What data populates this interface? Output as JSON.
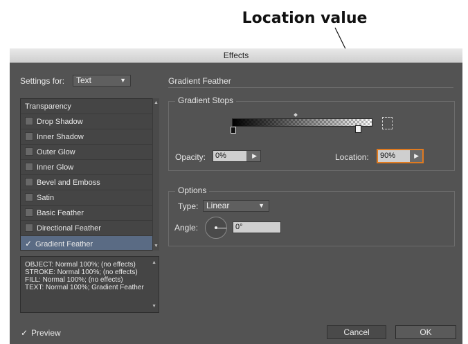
{
  "callout": {
    "text": "Location value"
  },
  "dialog": {
    "title": "Effects",
    "settings_for_label": "Settings for:",
    "settings_for_value": "Text",
    "section_title": "Gradient Feather",
    "effects_list": [
      {
        "label": "Transparency",
        "checkbox": false
      },
      {
        "label": "Drop Shadow",
        "checkbox": true,
        "checked": false
      },
      {
        "label": "Inner Shadow",
        "checkbox": true,
        "checked": false
      },
      {
        "label": "Outer Glow",
        "checkbox": true,
        "checked": false
      },
      {
        "label": "Inner Glow",
        "checkbox": true,
        "checked": false
      },
      {
        "label": "Bevel and Emboss",
        "checkbox": true,
        "checked": false
      },
      {
        "label": "Satin",
        "checkbox": true,
        "checked": false
      },
      {
        "label": "Basic Feather",
        "checkbox": true,
        "checked": false
      },
      {
        "label": "Directional Feather",
        "checkbox": true,
        "checked": false
      },
      {
        "label": "Gradient Feather",
        "checkbox": true,
        "checked": true,
        "selected": true
      }
    ],
    "summary_lines": [
      "OBJECT: Normal 100%; (no effects)",
      "STROKE: Normal 100%; (no effects)",
      "FILL: Normal 100%; (no effects)",
      "TEXT: Normal 100%; Gradient Feather"
    ],
    "gradient_stops": {
      "title": "Gradient Stops",
      "opacity_label": "Opacity:",
      "opacity_value": "0%",
      "location_label": "Location:",
      "location_value": "90%"
    },
    "options": {
      "title": "Options",
      "type_label": "Type:",
      "type_value": "Linear",
      "angle_label": "Angle:",
      "angle_value": "0°"
    },
    "preview_label": "Preview",
    "preview_checked": true,
    "cancel_label": "Cancel",
    "ok_label": "OK"
  },
  "colors": {
    "dialog_bg": "#535353",
    "highlight": "#e07a1f",
    "selection": "#5a6b84"
  }
}
